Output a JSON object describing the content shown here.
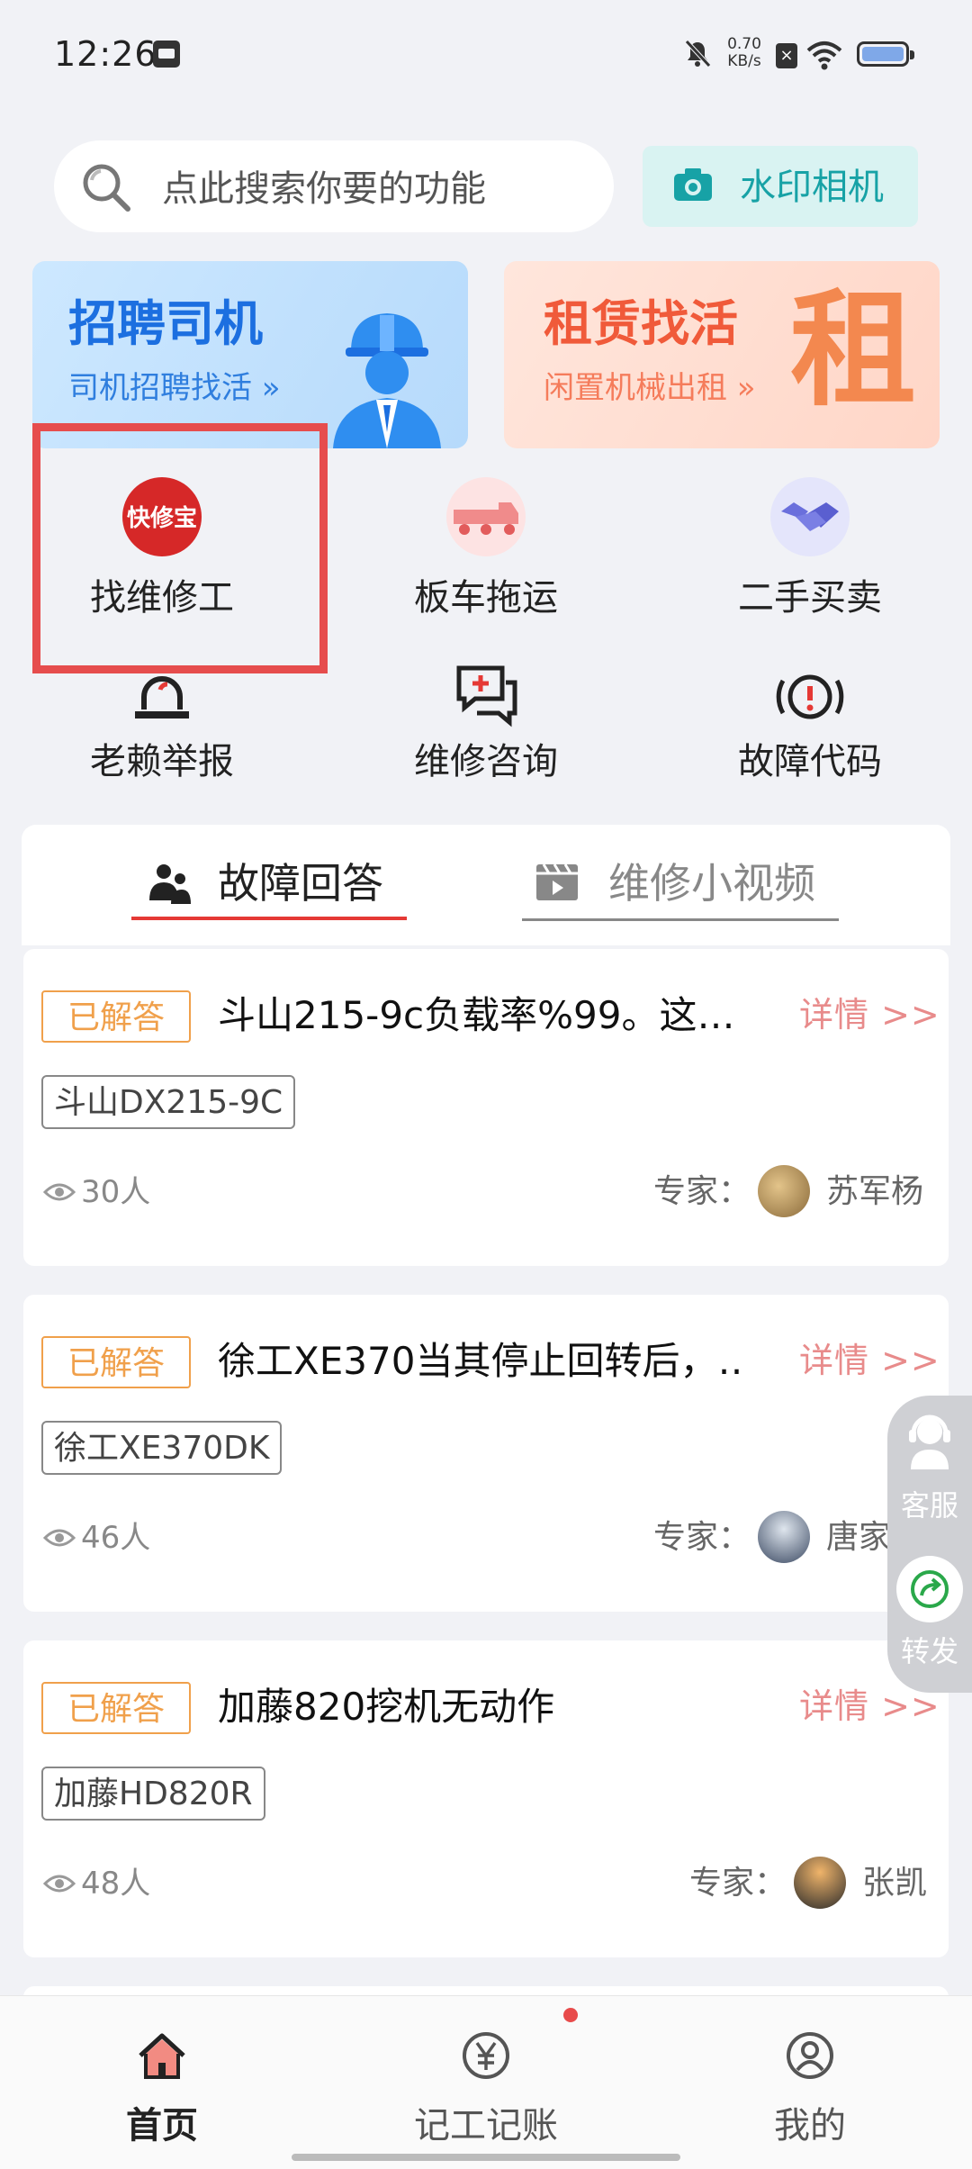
{
  "status_bar": {
    "time": "12:26",
    "net_speed_value": "0.70",
    "net_speed_unit": "KB/s",
    "x_signal": "×"
  },
  "search": {
    "placeholder": "点此搜索你要的功能",
    "camera_label": "水印相机"
  },
  "banners": {
    "driver": {
      "title": "招聘司机",
      "subtitle": "司机招聘找活 »"
    },
    "rent": {
      "title": "租赁找活",
      "subtitle": "闲置机械出租 »",
      "big_char": "租"
    }
  },
  "quick_grid": [
    {
      "label": "找维修工",
      "icon": "kuaixiubao-logo-icon",
      "icon_text": "快修宝"
    },
    {
      "label": "板车拖运",
      "icon": "truck-icon"
    },
    {
      "label": "二手买卖",
      "icon": "handshake-icon"
    },
    {
      "label": "老赖举报",
      "icon": "alarm-light-icon"
    },
    {
      "label": "维修咨询",
      "icon": "chat-plus-icon"
    },
    {
      "label": "故障代码",
      "icon": "warning-circle-icon"
    }
  ],
  "tabs": {
    "fault_answers": "故障回答",
    "repair_videos": "维修小视频"
  },
  "questions": [
    {
      "badge": "已解答",
      "title": "斗山215-9c负载率%99。这…",
      "detail": "详情 >>",
      "model": "斗山DX215-9C",
      "views": "30人",
      "expert_label": "专家：",
      "expert": "苏军杨"
    },
    {
      "badge": "已解答",
      "title": "徐工XE370当其停止回转后，…",
      "detail": "详情 >>",
      "model": "徐工XE370DK",
      "views": "46人",
      "expert_label": "专家：",
      "expert": "唐家威"
    },
    {
      "badge": "已解答",
      "title": "加藤820挖机无动作",
      "detail": "详情 >>",
      "model": "加藤HD820R",
      "views": "48人",
      "expert_label": "专家：",
      "expert": "张凯"
    }
  ],
  "float_bar": {
    "service": "客服",
    "share": "转发"
  },
  "bottom_nav": [
    {
      "label": "首页",
      "icon": "home-icon",
      "active": true
    },
    {
      "label": "记工记账",
      "icon": "yuan-icon",
      "active": false
    },
    {
      "label": "我的",
      "icon": "profile-icon",
      "active": false
    }
  ],
  "colors": {
    "accent_red": "#e53935",
    "answered_orange": "#f0a04b",
    "detail_pink": "#e88b8b",
    "teal": "#17a2a6"
  }
}
